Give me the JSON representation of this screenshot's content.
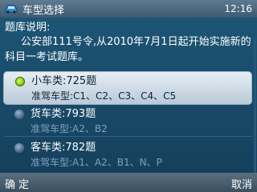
{
  "header": {
    "app_icon": "car-icon",
    "title": "车型选择",
    "clock": "12:16"
  },
  "intro": {
    "heading": "题库说明:",
    "text": "公安部111号令,从2010年7月1日起开始实施新的科目一考试题库。"
  },
  "options": [
    {
      "name": "小车类:725题",
      "license": "准驾车型:C1、C2、C3、C4、C5",
      "selected": true
    },
    {
      "name": "货车类:793题",
      "license": "准驾车型:A2、B2",
      "selected": false
    },
    {
      "name": "客车类:782题",
      "license": "准驾车型:A1、A2、B1、N、P",
      "selected": false
    }
  ],
  "softkeys": {
    "left": "确 定",
    "right": "取消"
  },
  "colors": {
    "accent_selected": "#86c812",
    "background": "#1a4866",
    "subtext": "#7fa1c2"
  }
}
